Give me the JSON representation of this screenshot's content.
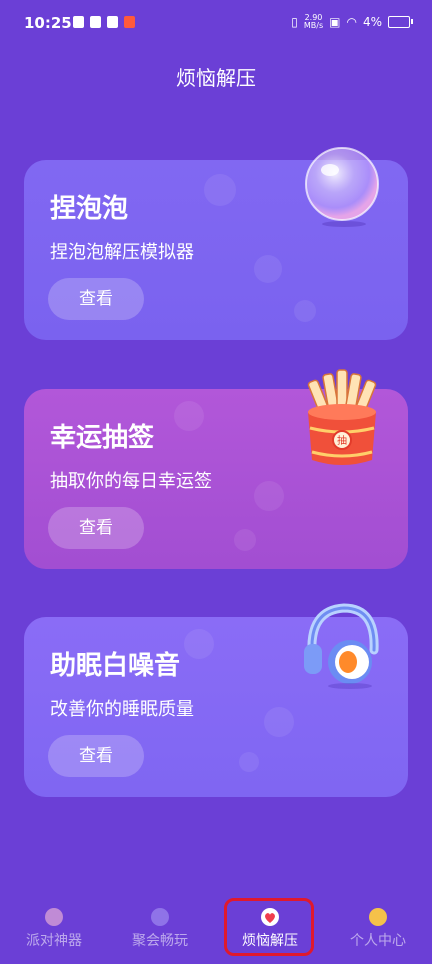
{
  "status": {
    "time": "10:25",
    "speed_value": "2.90",
    "speed_unit": "MB/s",
    "battery": "4%"
  },
  "page": {
    "title": "烦恼解压"
  },
  "cards": [
    {
      "title": "捏泡泡",
      "subtitle": "捏泡泡解压模拟器",
      "button": "查看",
      "icon": "bubble-icon"
    },
    {
      "title": "幸运抽签",
      "subtitle": "抽取你的每日幸运签",
      "button": "查看",
      "icon": "lucky-draw-icon",
      "badge": "抽"
    },
    {
      "title": "助眠白噪音",
      "subtitle": "改善你的睡眠质量",
      "button": "查看",
      "icon": "headphones-icon"
    }
  ],
  "nav": [
    {
      "label": "派对神器",
      "icon": "party-icon",
      "active": false
    },
    {
      "label": "聚会畅玩",
      "icon": "gathering-icon",
      "active": false
    },
    {
      "label": "烦恼解压",
      "icon": "relief-icon",
      "active": true
    },
    {
      "label": "个人中心",
      "icon": "profile-icon",
      "active": false
    }
  ],
  "colors": {
    "background": "#6b3fd6",
    "card_1": "#7f66f2",
    "card_2": "#a851d5",
    "card_3": "#8468f4",
    "highlight": "#e0192d"
  }
}
